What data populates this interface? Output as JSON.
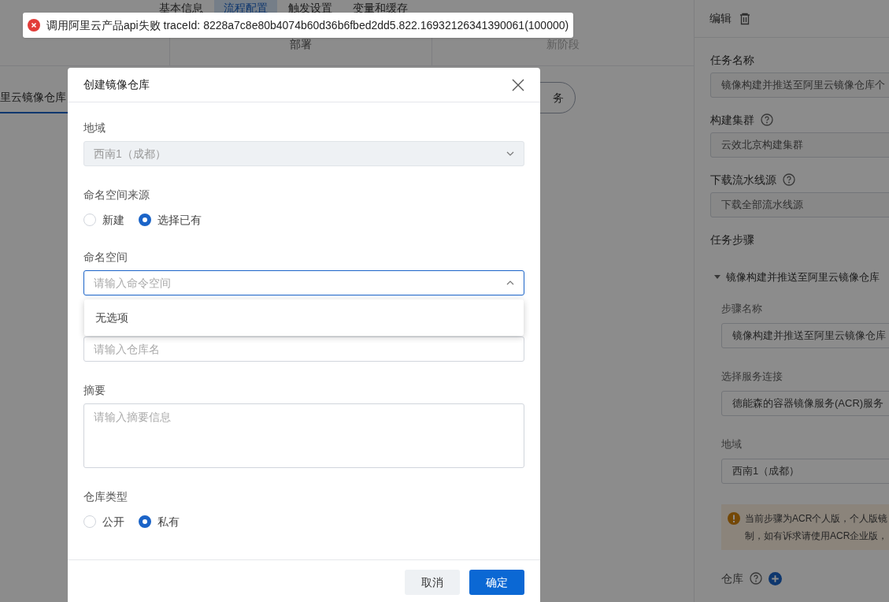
{
  "tabs": [
    {
      "label": "基本信息",
      "selected": false
    },
    {
      "label": "流程配置",
      "selected": true
    },
    {
      "label": "触发设置",
      "selected": false
    },
    {
      "label": "变量和缓存",
      "selected": false
    }
  ],
  "stages": [
    "部署",
    "新阶段"
  ],
  "pipeline_nodes": [
    {
      "label": "里云镜像仓库",
      "selected": true
    },
    {
      "label": "务",
      "selected": false
    }
  ],
  "edit_panel": {
    "title": "编辑",
    "fields": [
      {
        "label": "任务名称",
        "help": false,
        "value": "镜像构建并推送至阿里云镜像仓库个"
      },
      {
        "label": "构建集群",
        "help": true,
        "value": "云效北京构建集群"
      },
      {
        "label": "下载流水线源",
        "help": true,
        "value": "下载全部流水线源"
      }
    ],
    "steps_label": "任务步骤",
    "step": {
      "title": "镜像构建并推送至阿里云镜像仓库",
      "expanded": true,
      "fields": [
        {
          "label": "步骤名称",
          "value": "镜像构建并推送至阿里云镜像仓库"
        },
        {
          "label": "选择服务连接",
          "value": "德能森的容器镜像服务(ACR)服务"
        },
        {
          "label": "地域",
          "value": "西南1（成都）"
        }
      ],
      "warning": [
        "当前步骤为ACR个人版，个人版镜",
        "制，如有诉求请使用ACR企业版，"
      ],
      "repo_label": "仓库"
    }
  },
  "toast": {
    "message": "调用阿里云产品api失败 traceId: 8228a7c8e80b4074b60d36b6fbed2dd5.822.16932126341390061(100000)"
  },
  "modal": {
    "title": "创建镜像仓库",
    "fields": [
      {
        "kind": "select",
        "label": "地域",
        "value": "西南1（成都）",
        "disabled": true
      },
      {
        "kind": "radio",
        "label": "命名空间来源",
        "options": [
          {
            "label": "新建",
            "selected": false
          },
          {
            "label": "选择已有",
            "selected": true
          }
        ]
      },
      {
        "kind": "select",
        "label": "命名空间",
        "placeholder": "请输入命令空间",
        "disabled": false,
        "expanded": true,
        "menu": "无选项"
      },
      {
        "kind": "input",
        "placeholder": "请输入仓库名"
      },
      {
        "kind": "textarea",
        "label": "摘要",
        "placeholder": "请输入摘要信息"
      },
      {
        "kind": "radio",
        "label": "仓库类型",
        "options": [
          {
            "label": "公开",
            "selected": false
          },
          {
            "label": "私有",
            "selected": true
          }
        ]
      }
    ],
    "buttons": [
      {
        "label": "取消",
        "primary": false
      },
      {
        "label": "确定",
        "primary": true
      }
    ]
  }
}
